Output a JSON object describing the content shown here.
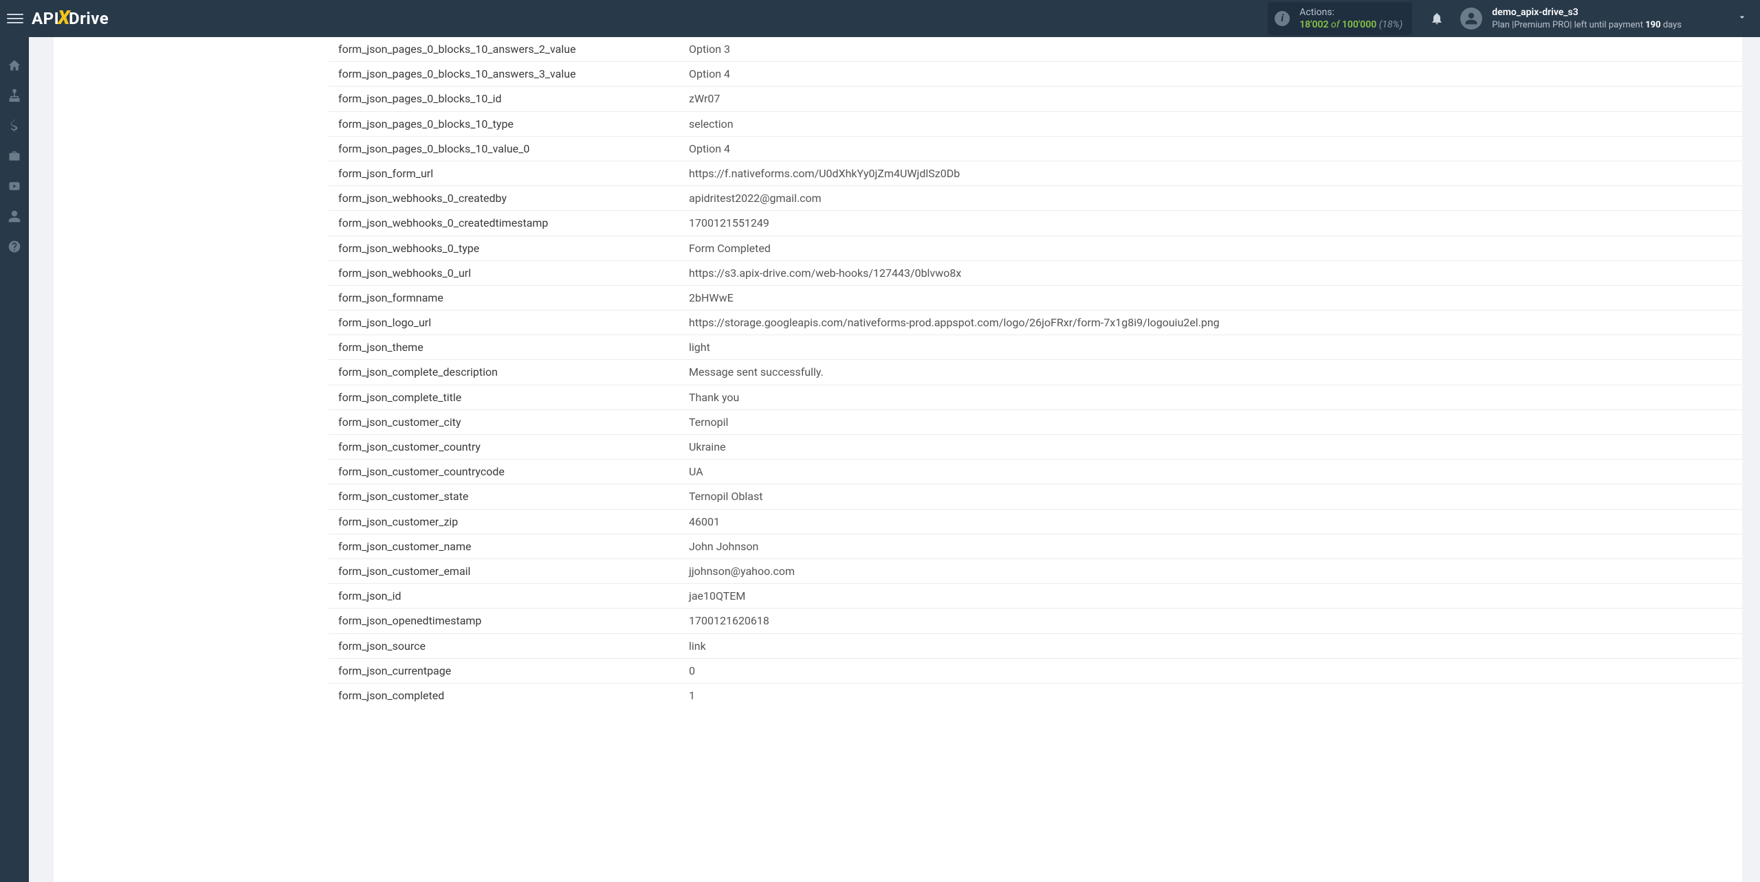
{
  "header": {
    "logo_api": "API",
    "logo_drive": "Drive",
    "actions": {
      "label": "Actions:",
      "used": "18'002",
      "of_word": "of",
      "total": "100'000",
      "percent": "(18%)"
    },
    "user": {
      "name": "demo_apix-drive_s3",
      "plan_prefix": "Plan |",
      "plan_name": "Premium PRO",
      "plan_sep": "|",
      "plan_suffix1": " left until payment ",
      "days": "190",
      "plan_suffix2": " days"
    }
  },
  "rows": [
    {
      "k": "form_json_pages_0_blocks_10_answers_2_value",
      "v": "Option 3"
    },
    {
      "k": "form_json_pages_0_blocks_10_answers_3_value",
      "v": "Option 4"
    },
    {
      "k": "form_json_pages_0_blocks_10_id",
      "v": "zWr07"
    },
    {
      "k": "form_json_pages_0_blocks_10_type",
      "v": "selection"
    },
    {
      "k": "form_json_pages_0_blocks_10_value_0",
      "v": "Option 4"
    },
    {
      "k": "form_json_form_url",
      "v": "https://f.nativeforms.com/U0dXhkYy0jZm4UWjdlSz0Db"
    },
    {
      "k": "form_json_webhooks_0_createdby",
      "v": "apidritest2022@gmail.com"
    },
    {
      "k": "form_json_webhooks_0_createdtimestamp",
      "v": "1700121551249"
    },
    {
      "k": "form_json_webhooks_0_type",
      "v": "Form Completed"
    },
    {
      "k": "form_json_webhooks_0_url",
      "v": "https://s3.apix-drive.com/web-hooks/127443/0blvwo8x"
    },
    {
      "k": "form_json_formname",
      "v": "2bHWwE"
    },
    {
      "k": "form_json_logo_url",
      "v": "https://storage.googleapis.com/nativeforms-prod.appspot.com/logo/26joFRxr/form-7x1g8i9/logouiu2el.png"
    },
    {
      "k": "form_json_theme",
      "v": "light"
    },
    {
      "k": "form_json_complete_description",
      "v": "Message sent successfully."
    },
    {
      "k": "form_json_complete_title",
      "v": "Thank you"
    },
    {
      "k": "form_json_customer_city",
      "v": "Ternopil"
    },
    {
      "k": "form_json_customer_country",
      "v": "Ukraine"
    },
    {
      "k": "form_json_customer_countrycode",
      "v": "UA"
    },
    {
      "k": "form_json_customer_state",
      "v": "Ternopil Oblast"
    },
    {
      "k": "form_json_customer_zip",
      "v": "46001"
    },
    {
      "k": "form_json_customer_name",
      "v": "John Johnson"
    },
    {
      "k": "form_json_customer_email",
      "v": "jjohnson@yahoo.com"
    },
    {
      "k": "form_json_id",
      "v": "jae10QTEM"
    },
    {
      "k": "form_json_openedtimestamp",
      "v": "1700121620618"
    },
    {
      "k": "form_json_source",
      "v": "link"
    },
    {
      "k": "form_json_currentpage",
      "v": "0"
    },
    {
      "k": "form_json_completed",
      "v": "1"
    }
  ]
}
